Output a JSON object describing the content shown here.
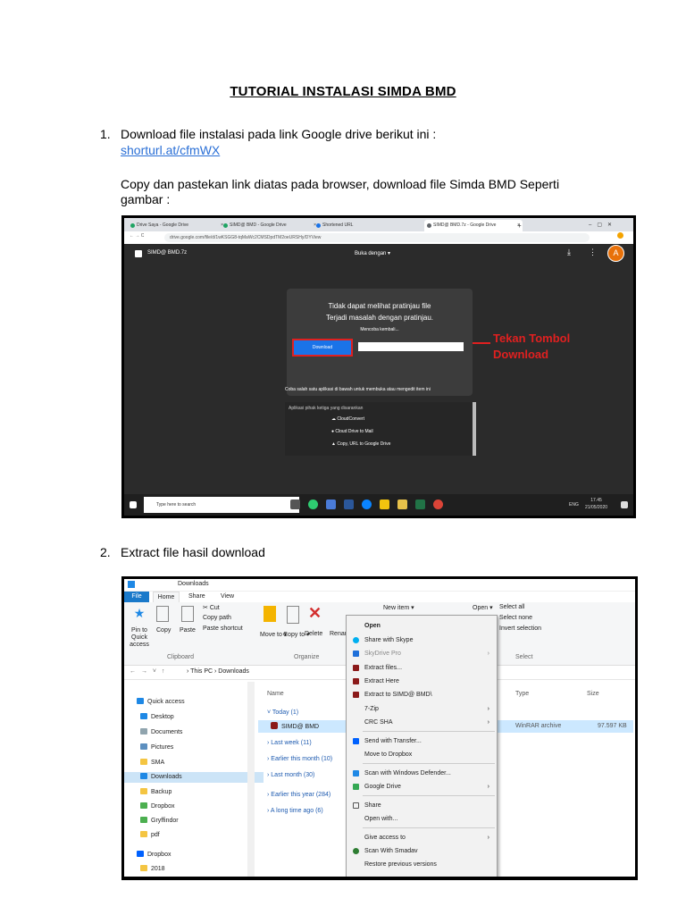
{
  "doc": {
    "title": "TUTORIAL INSTALASI SIMDA BMD",
    "step1_number": "1.",
    "step1_text": "Download file instalasi pada link Google drive berikut ini :",
    "step1_link": "shorturl.at/cfmWX",
    "step1_copy": "Copy dan pastekan link diatas pada browser, download file Simda BMD Seperti",
    "step1_copy2": "gambar :",
    "step2_number": "2.",
    "step2_text": "Extract file hasil download"
  },
  "browser": {
    "tabs": [
      "Drive Saya - Google Drive",
      "SIMD@ BMD - Google Drive",
      "Shortened URL",
      "SIMD@ BMD.7z - Google Drive"
    ],
    "tab_close": "×",
    "new_tab": "+",
    "address": "drive.google.com/file/d/1wKSGG8-tqMaWc2CMSDpdTM2oeURSHy/DYView",
    "nav_symbols": "← → C",
    "file_name": "SIMD@ BMD.7z",
    "open_with": "Buka dengan ▾",
    "dialog_line1": "Tidak dapat melihat pratinjau file",
    "dialog_line2": "Terjadi masalah dengan pratinjau.",
    "dialog_retry": "Mencoba kembali...",
    "download_button": "Download",
    "annotation_line1": "Tekan Tombol",
    "annotation_line2": "Download",
    "apps_hint": "Coba salah satu aplikasi di bawah untuk membuka atau mengedit item ini",
    "apps_header": "Aplikasi pihak ketiga yang disarankan",
    "apps": [
      "CloudConvert",
      "Cloud Drive to Mail",
      "Copy, URL to Google Drive"
    ],
    "taskbar_search": "Type here to search",
    "clock_time": "17.45",
    "clock_date": "21/05/2020",
    "lang": "ENG",
    "avatar_letter": "A"
  },
  "explorer": {
    "window_title": "Downloads",
    "ribbon_tabs": [
      "File",
      "Home",
      "Share",
      "View"
    ],
    "clipboard": {
      "pin": "Pin to Quick access",
      "copy": "Copy",
      "paste": "Paste",
      "cut": "Cut",
      "copy_path": "Copy path",
      "paste_shortcut": "Paste shortcut",
      "group": "Clipboard"
    },
    "organize": {
      "move": "Move to ▾",
      "copy": "Copy to ▾",
      "delete": "Delete",
      "rename": "Renar",
      "group": "Organize"
    },
    "new_item": "New item ▾",
    "open_btn": "Open ▾",
    "select": {
      "all": "Select all",
      "none": "Select none",
      "invert": "Invert selection",
      "group": "Select"
    },
    "breadcrumb": "› This PC › Downloads",
    "nav_arrows": "← → ˅ ↑",
    "sidebar": [
      "Quick access",
      "Desktop",
      "Documents",
      "Pictures",
      "SMA",
      "Downloads",
      "Backup",
      "Dropbox",
      "Gryffindor",
      "pdf",
      "Dropbox",
      "2018"
    ],
    "columns": {
      "name": "Name",
      "type": "Type",
      "size": "Size"
    },
    "groups": [
      "Today (1)",
      "Last week (11)",
      "Earlier this month (10)",
      "Last month (30)",
      "Earlier this year (284)",
      "A long time ago (6)"
    ],
    "file": {
      "name": "SIMD@ BMD",
      "type": "WinRAR archive",
      "size": "97.597 KB"
    },
    "context_menu": [
      "Open",
      "Share with Skype",
      "SkyDrive Pro",
      "Extract files...",
      "Extract Here",
      "Extract to SIMD@ BMD\\",
      "7-Zip",
      "CRC SHA",
      "Send with Transfer...",
      "Move to Dropbox",
      "Scan with Windows Defender...",
      "Google Drive",
      "Share",
      "Open with...",
      "Give access to",
      "Scan With Smadav",
      "Restore previous versions"
    ],
    "submenu_arrow": "›"
  },
  "colors": {
    "link": "#2a6fd6",
    "annotation": "#e02020",
    "download_blue": "#1a73e8"
  }
}
